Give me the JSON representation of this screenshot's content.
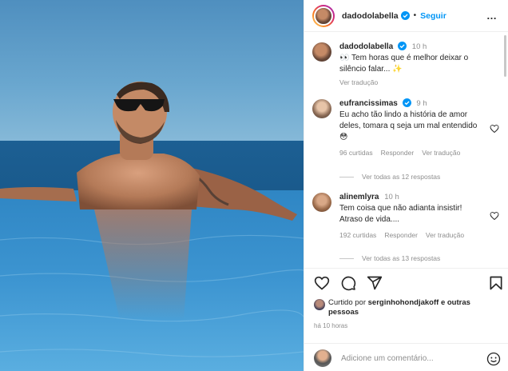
{
  "post": {
    "author": "dadodolabella",
    "follow_label": "Seguir",
    "dot": "•",
    "more_label": "…"
  },
  "comments": [
    {
      "user": "dadodolabella",
      "time": "10 h",
      "text": "👀 Tem horas que é melhor deixar o silêncio falar... ✨",
      "translate": "Ver tradução"
    },
    {
      "user": "eufrancissimas",
      "time": "9 h",
      "text": "Eu acho tão lindo a história de amor deles, tomara q seja um mal entendido 😳",
      "likes": "96 curtidas",
      "reply": "Responder",
      "translate": "Ver tradução",
      "replies": "Ver todas as 12 respostas"
    },
    {
      "user": "alinemlyra",
      "time": "10 h",
      "text": "Tem coisa que não adianta insistir! Atraso de vida....",
      "likes": "192 curtidas",
      "reply": "Responder",
      "translate": "Ver tradução",
      "replies": "Ver todas as 13 respostas"
    }
  ],
  "likes": {
    "prefix": "Curtido por",
    "user": "serginhohondjakoff",
    "suffix": "e outras pessoas"
  },
  "posted_ago": "há 10 horas",
  "comment_input": {
    "placeholder": "Adicione um comentário..."
  },
  "icons": [
    "verified-icon",
    "more-icon",
    "heart-icon",
    "comment-icon",
    "share-icon",
    "save-icon",
    "emoji-icon"
  ],
  "colors": {
    "accent": "#0095f6",
    "text": "#262626",
    "muted": "#8e8e8e",
    "sea": "#1f6fa8",
    "sky": "#5f9fc9"
  }
}
